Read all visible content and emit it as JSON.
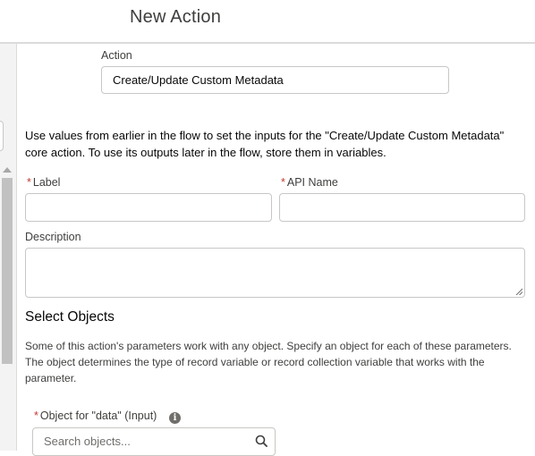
{
  "header": {
    "title": "New Action"
  },
  "action": {
    "label": "Action",
    "value": "Create/Update Custom Metadata"
  },
  "intro_text": "Use values from earlier in the flow to set the inputs for the \"Create/Update Custom Metadata\" core action. To use its outputs later in the flow, store them in variables.",
  "fields": {
    "required_marker": "*",
    "label": {
      "label": "Label",
      "value": ""
    },
    "api_name": {
      "label": "API Name",
      "value": ""
    },
    "description": {
      "label": "Description",
      "value": ""
    }
  },
  "select_objects": {
    "title": "Select Objects",
    "help_text": "Some of this action's parameters work with any object. Specify an object for each of these parameters. The object determines the type of record variable or record collection variable that works with the parameter.",
    "object_field": {
      "label": "Object for \"data\" (Input)",
      "info_icon_glyph": "i",
      "placeholder": "Search objects..."
    }
  },
  "colors": {
    "required": "#c23934",
    "border": "#c9c7c5",
    "text": "#3e3e3c"
  }
}
